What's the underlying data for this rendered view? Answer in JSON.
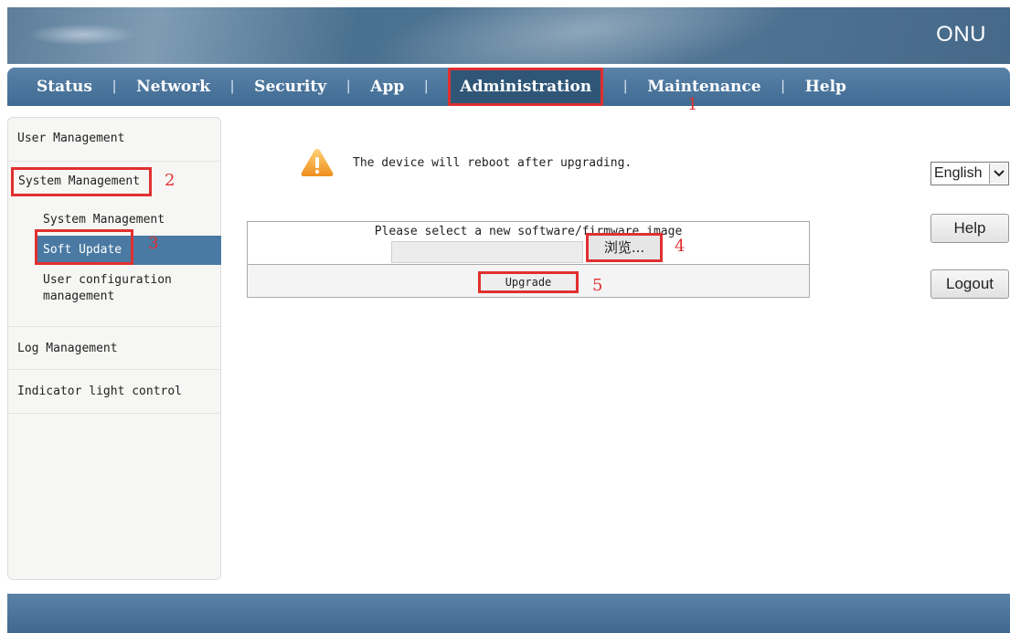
{
  "header": {
    "product_name": "ONU"
  },
  "nav": {
    "items": [
      {
        "label": "Status"
      },
      {
        "label": "Network"
      },
      {
        "label": "Security"
      },
      {
        "label": "App"
      },
      {
        "label": "Administration",
        "active": true
      },
      {
        "label": "Maintenance"
      },
      {
        "label": "Help"
      }
    ],
    "separator": "|"
  },
  "sidebar": {
    "user_management": "User Management",
    "system_management": "System Management",
    "sub_items": {
      "system_management": "System Management",
      "soft_update": "Soft Update",
      "user_config_line1": "User configuration",
      "user_config_line2": "management"
    },
    "log_management": "Log Management",
    "indicator_light_control": "Indicator light control"
  },
  "main": {
    "warning": "The device will reboot after upgrading.",
    "form_label": "Please select a new software/firmware image",
    "file_value": "",
    "browse_label": "浏览...",
    "upgrade_label": "Upgrade"
  },
  "right_panel": {
    "language_value": "English",
    "help_label": "Help",
    "logout_label": "Logout"
  },
  "annotations": {
    "markers": [
      "1",
      "2",
      "3",
      "4",
      "5"
    ],
    "color": "#e03030"
  },
  "colors": {
    "nav_bar": "#4a77a0",
    "selected_item": "#4a7aa3",
    "highlight_box": "#e03030",
    "warning_icon": "#f0a22c"
  },
  "icons": {
    "warning": "warning-triangle-icon",
    "dropdown": "chevron-down-icon"
  }
}
